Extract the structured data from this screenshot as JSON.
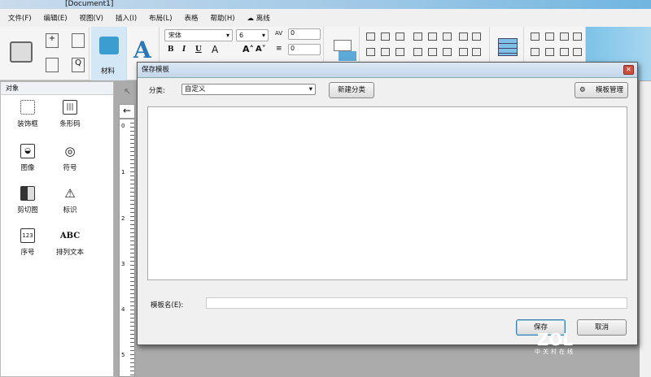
{
  "window": {
    "title": "[Document1]"
  },
  "menu": [
    "文件(F)",
    "编辑(E)",
    "视图(V)",
    "插入(I)",
    "布局(L)",
    "表格",
    "帮助(H)",
    "离线"
  ],
  "ribbon": {
    "material_label": "材料",
    "font_name": "宋体",
    "font_size": "6",
    "char_spacing": "0",
    "line_spacing": "0",
    "bold": "B",
    "italic": "I",
    "underline": "U",
    "font_color": "A"
  },
  "objects_panel": {
    "title": "对象",
    "items": [
      {
        "label": "装饰框",
        "icon": "frame-icon"
      },
      {
        "label": "条形码",
        "icon": "barcode-icon"
      },
      {
        "label": "图像",
        "icon": "image-icon"
      },
      {
        "label": "符号",
        "icon": "symbol-icon"
      },
      {
        "label": "剪切图",
        "icon": "clipart-icon"
      },
      {
        "label": "标识",
        "icon": "warning-sign-icon"
      },
      {
        "label": "序号",
        "icon": "serial-number-icon"
      },
      {
        "label": "排列文本",
        "icon": "arranged-text-icon"
      }
    ]
  },
  "ruler": {
    "ticks": [
      "0",
      "1",
      "2",
      "3",
      "4",
      "5"
    ]
  },
  "dialog": {
    "title": "保存模板",
    "category_label": "分类:",
    "category_value": "自定义",
    "new_category": "新建分类",
    "manage_templates": "模板管理",
    "name_label": "模板名(E):",
    "name_value": "",
    "save": "保存",
    "cancel": "取消"
  },
  "watermark": {
    "logo": "ZOL",
    "sub": "中关村在线"
  }
}
